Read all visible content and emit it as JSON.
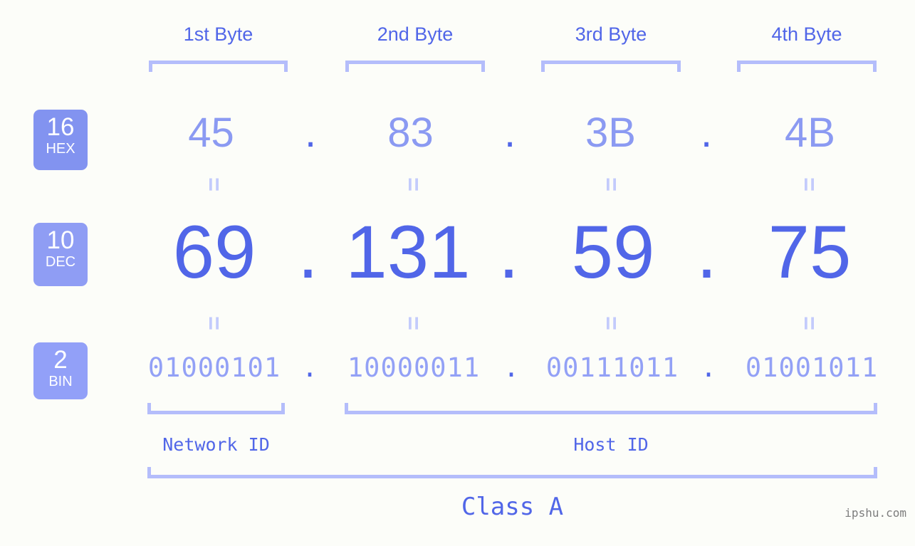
{
  "background_color": "#fcfdf9",
  "accent_colors": {
    "deep_blue": "#5166e8",
    "mid_blue": "#8b9af2",
    "light_blue": "#b4bdfb",
    "badge_blue": "#8293f0",
    "watermark_gray": "#7d7d7d"
  },
  "byte_headers": [
    {
      "label": "1st Byte"
    },
    {
      "label": "2nd Byte"
    },
    {
      "label": "3rd Byte"
    },
    {
      "label": "4th Byte"
    }
  ],
  "bases": [
    {
      "number": "16",
      "name": "HEX"
    },
    {
      "number": "10",
      "name": "DEC"
    },
    {
      "number": "2",
      "name": "BIN"
    }
  ],
  "separator": ".",
  "equals_sign": "=",
  "rows": {
    "hex": {
      "values": [
        "45",
        "83",
        "3B",
        "4B"
      ]
    },
    "dec": {
      "values": [
        "69",
        "131",
        "59",
        "75"
      ]
    },
    "bin": {
      "values": [
        "01000101",
        "10000011",
        "00111011",
        "01001011"
      ]
    }
  },
  "ip_address": {
    "dotted_decimal": "69.131.59.75",
    "dotted_hex": "45.83.3B.4B",
    "dotted_binary": "01000101.10000011.00111011.01001011"
  },
  "id_labels": [
    {
      "label": "Network ID"
    },
    {
      "label": "Host ID"
    }
  ],
  "class_label": "Class A",
  "watermark": "ipshu.com"
}
